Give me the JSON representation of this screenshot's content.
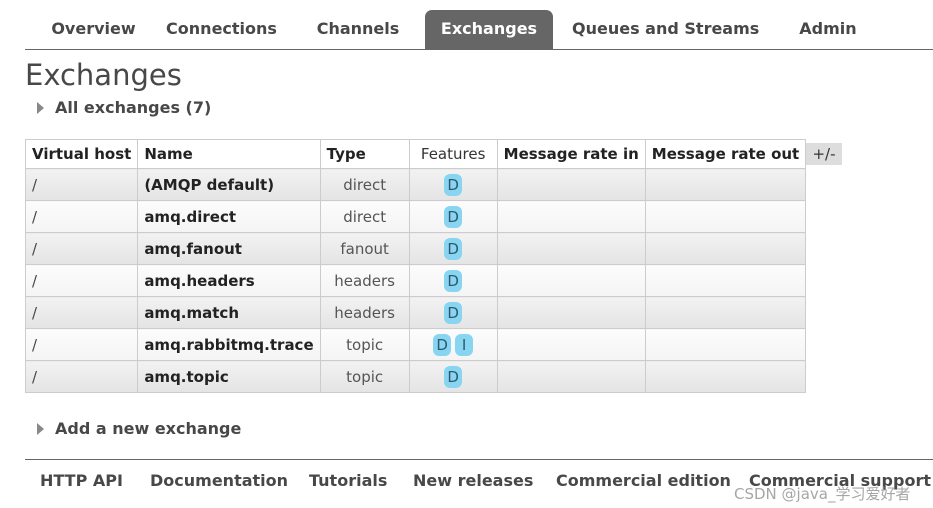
{
  "nav": {
    "tabs": [
      {
        "label": "Overview"
      },
      {
        "label": "Connections"
      },
      {
        "label": "Channels"
      },
      {
        "label": "Exchanges"
      },
      {
        "label": "Queues and Streams"
      },
      {
        "label": "Admin"
      }
    ],
    "active_tab": "Exchanges"
  },
  "page": {
    "title": "Exchanges",
    "all_section_label": "All exchanges (7)",
    "add_section_label": "Add a new exchange"
  },
  "table": {
    "columns": [
      "Virtual host",
      "Name",
      "Type",
      "Features",
      "Message rate in",
      "Message rate out"
    ],
    "toggle_columns_label": "+/-",
    "rows": [
      {
        "vhost": "/",
        "name": "(AMQP default)",
        "type": "direct",
        "features": [
          "D"
        ],
        "rate_in": "",
        "rate_out": ""
      },
      {
        "vhost": "/",
        "name": "amq.direct",
        "type": "direct",
        "features": [
          "D"
        ],
        "rate_in": "",
        "rate_out": ""
      },
      {
        "vhost": "/",
        "name": "amq.fanout",
        "type": "fanout",
        "features": [
          "D"
        ],
        "rate_in": "",
        "rate_out": ""
      },
      {
        "vhost": "/",
        "name": "amq.headers",
        "type": "headers",
        "features": [
          "D"
        ],
        "rate_in": "",
        "rate_out": ""
      },
      {
        "vhost": "/",
        "name": "amq.match",
        "type": "headers",
        "features": [
          "D"
        ],
        "rate_in": "",
        "rate_out": ""
      },
      {
        "vhost": "/",
        "name": "amq.rabbitmq.trace",
        "type": "topic",
        "features": [
          "D",
          "I"
        ],
        "rate_in": "",
        "rate_out": ""
      },
      {
        "vhost": "/",
        "name": "amq.topic",
        "type": "topic",
        "features": [
          "D"
        ],
        "rate_in": "",
        "rate_out": ""
      }
    ]
  },
  "footer": {
    "links": [
      {
        "label": "HTTP API"
      },
      {
        "label": "Documentation"
      },
      {
        "label": "Tutorials"
      },
      {
        "label": "New releases"
      },
      {
        "label": "Commercial edition"
      },
      {
        "label": "Commercial support"
      }
    ]
  },
  "watermark": "CSDN @java_学习爱好者",
  "colors": {
    "active_tab_bg": "#666666",
    "feature_badge_bg": "#88d5f2",
    "text": "#484848"
  }
}
